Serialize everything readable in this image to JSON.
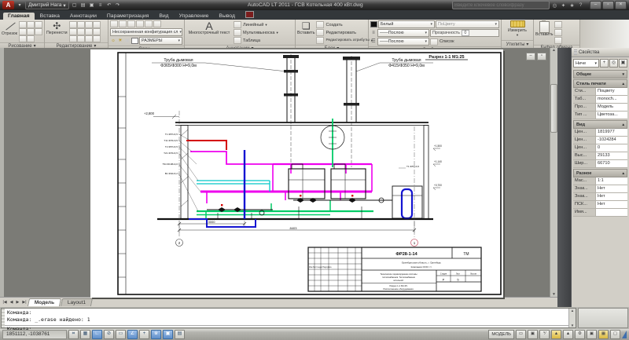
{
  "titlebar": {
    "logo_letter": "A",
    "user_menu": "Дмитрий Нага",
    "title": "AutoCAD LT 2011 - ГСВ Котельная 400 кВт.dwg",
    "search_placeholder": "Введите ключевое слово/фразу"
  },
  "ribbon": {
    "tabs": [
      "Главная",
      "Вставка",
      "Аннотации",
      "Параметризация",
      "Вид",
      "Управление",
      "Вывод"
    ],
    "draw": {
      "label": "Рисование",
      "line": "Отрезок"
    },
    "modify": {
      "label": "Редактирование",
      "move": "Перенести"
    },
    "layers": {
      "label": "Слои",
      "config": "Несохраненная конфигурация сл",
      "current": "РАЗМЕРЫ"
    },
    "annotate": {
      "label": "Аннотации",
      "letter": "А",
      "mtext": "Многострочный текст",
      "linear": "Линейный",
      "mleader": "Мультивыноска",
      "table": "Таблица"
    },
    "block": {
      "label": "Блок",
      "insert": "Вставить",
      "create": "Создать",
      "edit": "Редактировать",
      "edit_attr": "Редактировать атрибуты"
    },
    "props": {
      "label": "Свойства",
      "color": "Белый",
      "bycolor": "ПоЦвету",
      "lineweight": "Послою",
      "linetype": "Послою",
      "transparency": "Прозрачность",
      "transparency_value": "0",
      "list": "Список"
    },
    "utils": {
      "label": "Утилиты",
      "measure": "Измерить"
    },
    "clipboard": {
      "label": "Буфер обмена",
      "paste": "Вставить"
    }
  },
  "palette": {
    "title": "Свойства",
    "selector": "Ниче",
    "general": {
      "title": "Общие"
    },
    "plot": {
      "title": "Стиль печати",
      "rows": [
        [
          "Сти...",
          "Поцвету"
        ],
        [
          "Таб...",
          "monoch..."
        ],
        [
          "Про...",
          "Модель"
        ],
        [
          "Тип ...",
          "Цветоза..."
        ]
      ]
    },
    "view": {
      "title": "Вид",
      "rows": [
        [
          "Цен...",
          "1819977"
        ],
        [
          "Цен...",
          "-1024284"
        ],
        [
          "Цен...",
          "0"
        ],
        [
          "Выс...",
          "29133"
        ],
        [
          "Шир...",
          "66710"
        ]
      ]
    },
    "misc": {
      "title": "Разное",
      "rows": [
        [
          "Мас...",
          "1:1"
        ],
        [
          "Знак...",
          "Нет"
        ],
        [
          "Знак...",
          "Нет"
        ],
        [
          "ПСК...",
          "Нет"
        ],
        [
          "Имя...",
          ""
        ]
      ]
    }
  },
  "drawing": {
    "section_title": "Разрез 1-1 М1:25",
    "chimney_left": [
      "Труба дымовая",
      "Ф365/Ф300 Н=9,0м"
    ],
    "chimney_right": [
      "Труба дымовая",
      "Ф415/Ф350 Н=9,0м"
    ],
    "elevation": "+2,800",
    "elevations_right": [
      "+1,500",
      "+1,140",
      "+0,700"
    ],
    "pipe_labels": [
      "Т1 Ф57х3,5",
      "Т11 Ф76х3,5",
      "Т2 Ф57х3,5",
      "Т21 Ф76х3,5",
      "Т94 Ф108х4,0",
      "В1 Ф32х3,2"
    ],
    "pipe_label_right": "Т1 Ф57х3,5",
    "dim_small": "3000",
    "dim_large": "8403",
    "axis_left": "2",
    "axis_right": "1",
    "titleblock": {
      "code": "ФР28-1-14",
      "mark": "ТМ",
      "region": "Оренбургская область, г. Оренбург,",
      "company": "Компания ООО <>",
      "desc1": "Техническое перевооружение системы",
      "desc2": "теплоснабжения. Теплоснабжение",
      "desc3": "котельной.",
      "sub1": "Разрез 1-1 М1:25.",
      "sub2": "Расположение оборудования.",
      "stage_label": "Стадия",
      "sheet_label": "Лист",
      "sheets_label": "Листов",
      "stage": "Р",
      "sheet": "5",
      "rev_row": "Изм Лист №док Подп Дата"
    }
  },
  "layout_tabs": {
    "model": "Модель",
    "layout1": "Layout1"
  },
  "command": {
    "history1": "Команда:",
    "history2": "Команда: _.erase найдено: 1",
    "prompt": "Команда:"
  },
  "statusbar": {
    "coords": "1851112, -1038761",
    "model_label": "МОДЕЛЬ",
    "toggles": [
      {
        "glyph": "⌗",
        "on": false
      },
      {
        "glyph": "▦",
        "on": false
      },
      {
        "glyph": "∟",
        "on": true
      },
      {
        "glyph": "⊘",
        "on": false
      },
      {
        "glyph": "▭",
        "on": false
      },
      {
        "glyph": "∠",
        "on": true
      },
      {
        "glyph": "+",
        "on": false
      },
      {
        "glyph": "※",
        "on": true
      },
      {
        "glyph": "▣",
        "on": true
      },
      {
        "glyph": "▤",
        "on": false
      }
    ]
  }
}
